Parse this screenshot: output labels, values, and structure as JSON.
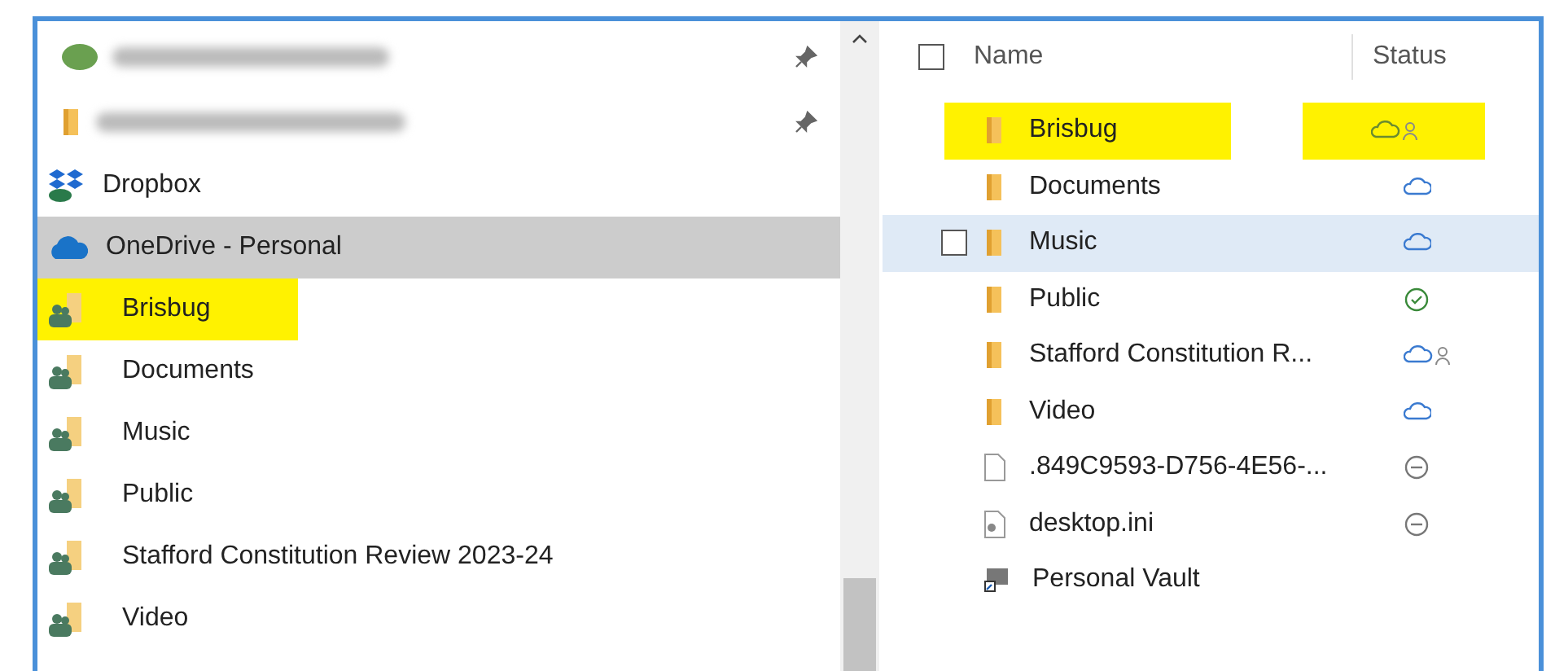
{
  "navigation_pane": {
    "quick_access": [
      {
        "kind": "app",
        "pinned": true
      },
      {
        "kind": "folder",
        "pinned": true
      }
    ],
    "items": [
      {
        "kind": "dropbox",
        "label": "Dropbox",
        "selected": false,
        "highlighted": false
      },
      {
        "kind": "onedrive",
        "label": "OneDrive - Personal",
        "selected": true,
        "highlighted": false,
        "children": [
          {
            "kind": "shared-folder",
            "label": "Brisbug",
            "selected": false,
            "highlighted": true
          },
          {
            "kind": "shared-folder",
            "label": "Documents",
            "selected": false,
            "highlighted": false
          },
          {
            "kind": "shared-folder",
            "label": "Music",
            "selected": false,
            "highlighted": false
          },
          {
            "kind": "shared-folder",
            "label": "Public",
            "selected": false,
            "highlighted": false
          },
          {
            "kind": "shared-folder",
            "label": "Stafford Constitution Review 2023-24",
            "selected": false,
            "highlighted": false
          },
          {
            "kind": "shared-folder",
            "label": "Video",
            "selected": false,
            "highlighted": false
          }
        ]
      }
    ]
  },
  "file_list": {
    "select_all": {
      "checked": false
    },
    "columns": [
      "Name",
      "Status"
    ],
    "rows": [
      {
        "kind": "folder",
        "name": "Brisbug",
        "status": {
          "kind": "cloud",
          "shared": true
        },
        "hovered": false,
        "highlighted": true
      },
      {
        "kind": "folder",
        "name": "Documents",
        "status": {
          "kind": "cloud",
          "shared": false
        },
        "hovered": false,
        "highlighted": false
      },
      {
        "kind": "folder",
        "name": "Music",
        "status": {
          "kind": "cloud",
          "shared": false
        },
        "hovered": true,
        "highlighted": false
      },
      {
        "kind": "folder",
        "name": "Public",
        "status": {
          "kind": "synced",
          "shared": false
        },
        "hovered": false,
        "highlighted": false
      },
      {
        "kind": "folder",
        "name": "Stafford Constitution R...",
        "status": {
          "kind": "cloud",
          "shared": true
        },
        "hovered": false,
        "highlighted": false
      },
      {
        "kind": "folder",
        "name": "Video",
        "status": {
          "kind": "cloud",
          "shared": false
        },
        "hovered": false,
        "highlighted": false
      },
      {
        "kind": "file",
        "name": ".849C9593-D756-4E56-...",
        "status": {
          "kind": "excluded",
          "shared": false
        },
        "hovered": false,
        "highlighted": false
      },
      {
        "kind": "settings-file",
        "name": "desktop.ini",
        "status": {
          "kind": "excluded",
          "shared": false
        },
        "hovered": false,
        "highlighted": false
      },
      {
        "kind": "shortcut",
        "name": "Personal Vault",
        "hovered": false,
        "highlighted": false
      }
    ]
  }
}
